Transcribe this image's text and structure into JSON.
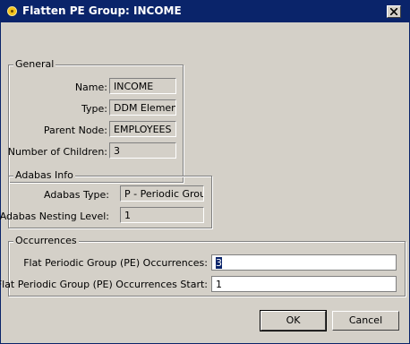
{
  "window": {
    "title": "Flatten PE Group: INCOME"
  },
  "general": {
    "legend": "General",
    "fields": [
      {
        "label": "Name:",
        "value": "INCOME"
      },
      {
        "label": "Type:",
        "value": "DDM Element"
      },
      {
        "label": "Parent Node:",
        "value": "EMPLOYEES"
      },
      {
        "label": "Number of Children:",
        "value": "3"
      }
    ]
  },
  "adabas": {
    "legend": "Adabas Info",
    "fields": [
      {
        "label": "Adabas Type:",
        "value": "P - Periodic Group"
      },
      {
        "label": "Adabas Nesting Level:",
        "value": "1"
      }
    ]
  },
  "occurrences": {
    "legend": "Occurrences",
    "fields": [
      {
        "label": "Flat Periodic Group (PE) Occurrences:",
        "value": "3"
      },
      {
        "label": "Flat Periodic Group (PE) Occurrences Start:",
        "value": "1"
      }
    ]
  },
  "buttons": {
    "ok": "OK",
    "cancel": "Cancel"
  }
}
